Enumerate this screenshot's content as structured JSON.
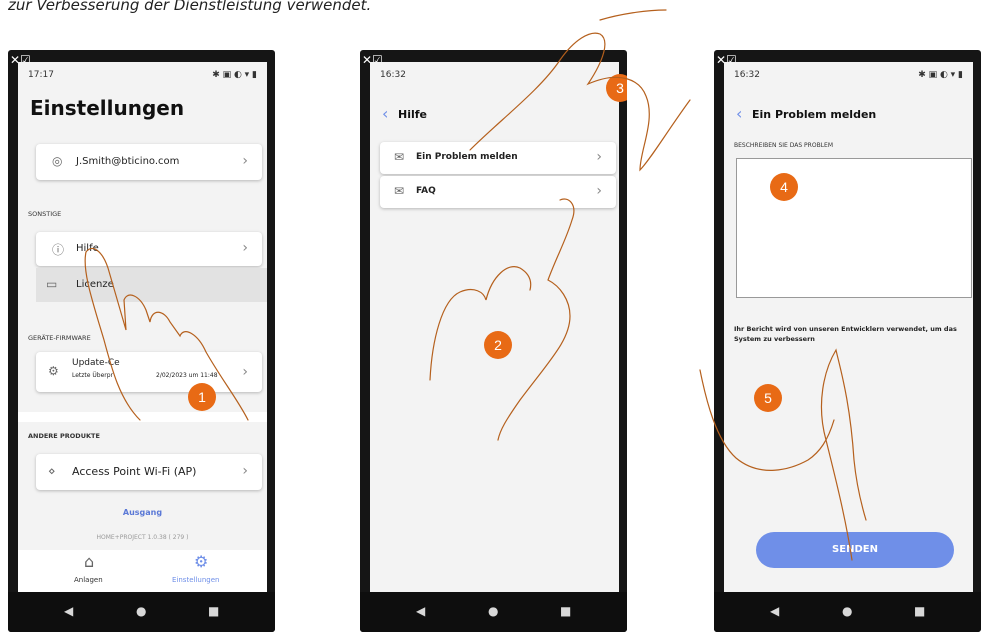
{
  "caption": "zur Verbesserung der Dienstleistung verwendet.",
  "os_marker": "✕☑",
  "phone1": {
    "time": "17:17",
    "status_right": "✱ ▣ ◐ ▾ ▮",
    "title": "Einstellungen",
    "account_email": "J.Smith@bticino.com",
    "section_other": "SONSTIGE",
    "help_label": "Hilfe",
    "licence_label": "Licenze",
    "section_firmware": "GERÄTE-FIRMWARE",
    "update_label": "Update-Ce",
    "update_sub": "Letzte Überpr",
    "update_date": "2/02/2023 um 11:48",
    "section_other_products": "ANDERE PRODUKTE",
    "access_point_label": "Access Point Wi-Fi (AP)",
    "logout_label": "Ausgang",
    "version": "HOME+PROJECT 1.0.38 ( 279 )",
    "tab_plants": "Anlagen",
    "tab_settings": "Einstellungen",
    "step": "1"
  },
  "phone2": {
    "time": "16:32",
    "back_title": "Hilfe",
    "report_label": "Ein Problem melden",
    "faq_label": "FAQ",
    "step_a": "3",
    "step_b": "2"
  },
  "phone3": {
    "time": "16:32",
    "status_right": "✱ ▣ ◐ ▾ ▮",
    "back_title": "Ein Problem melden",
    "describe_label": "BESCHREIBEN SIE DAS PROBLEM",
    "note": "Ihr Bericht wird von unseren Entwicklern verwendet, um das System zu verbessern",
    "send_label": "SENDEN",
    "step_a": "4",
    "step_b": "5"
  },
  "colors": {
    "accent": "#e86a15",
    "button": "#6f8fe8",
    "link": "#5a78d6"
  }
}
